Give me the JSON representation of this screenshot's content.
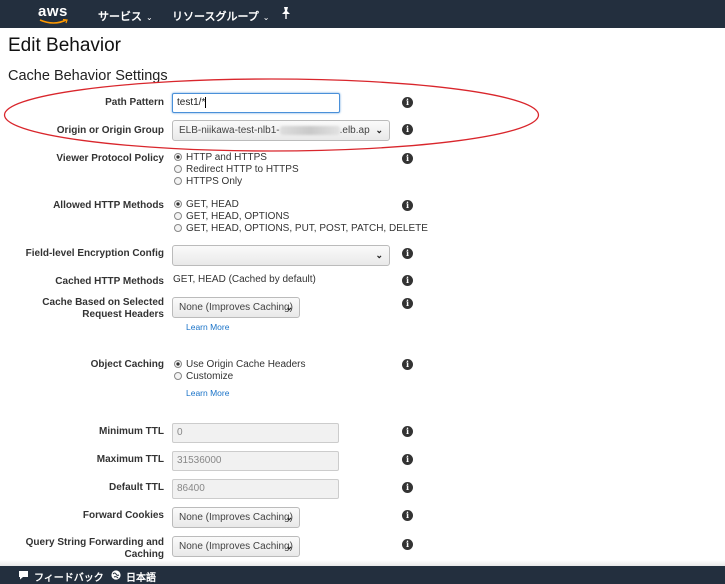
{
  "header": {
    "logo_text": "aws",
    "nav": [
      {
        "label": "サービス"
      },
      {
        "label": "リソースグループ"
      }
    ]
  },
  "page": {
    "title": "Edit Behavior",
    "section": "Cache Behavior Settings"
  },
  "form": {
    "path_pattern": {
      "label": "Path Pattern",
      "value": "test1/*"
    },
    "origin": {
      "label": "Origin or Origin Group",
      "value_start": "ELB-niikawa-test-nlb1-",
      "value_end": ".elb.ap"
    },
    "viewer_protocol": {
      "label": "Viewer Protocol Policy",
      "options": [
        "HTTP and HTTPS",
        "Redirect HTTP to HTTPS",
        "HTTPS Only"
      ],
      "selected": 0
    },
    "allowed_methods": {
      "label": "Allowed HTTP Methods",
      "options": [
        "GET, HEAD",
        "GET, HEAD, OPTIONS",
        "GET, HEAD, OPTIONS, PUT, POST, PATCH, DELETE"
      ],
      "selected": 0
    },
    "fle_config": {
      "label": "Field-level Encryption Config",
      "value": ""
    },
    "cached_methods": {
      "label": "Cached HTTP Methods",
      "value": "GET, HEAD (Cached by default)"
    },
    "cache_headers": {
      "label_line1": "Cache Based on Selected",
      "label_line2": "Request Headers",
      "value": "None (Improves Caching)",
      "learn_more": "Learn More"
    },
    "object_caching": {
      "label": "Object Caching",
      "options": [
        "Use Origin Cache Headers",
        "Customize"
      ],
      "selected": 0,
      "learn_more": "Learn More"
    },
    "min_ttl": {
      "label": "Minimum TTL",
      "value": "0"
    },
    "max_ttl": {
      "label": "Maximum TTL",
      "value": "31536000"
    },
    "default_ttl": {
      "label": "Default TTL",
      "value": "86400"
    },
    "forward_cookies": {
      "label": "Forward Cookies",
      "value": "None (Improves Caching)"
    },
    "query_string": {
      "label_line1": "Query String Forwarding and",
      "label_line2": "Caching",
      "value": "None (Improves Caching)"
    }
  },
  "info_glyph": "i",
  "footer": {
    "feedback": "フィードバック",
    "language": "日本語"
  },
  "colors": {
    "topbar": "#232f3e",
    "annotation": "#d9262c",
    "link": "#1a73c8"
  }
}
